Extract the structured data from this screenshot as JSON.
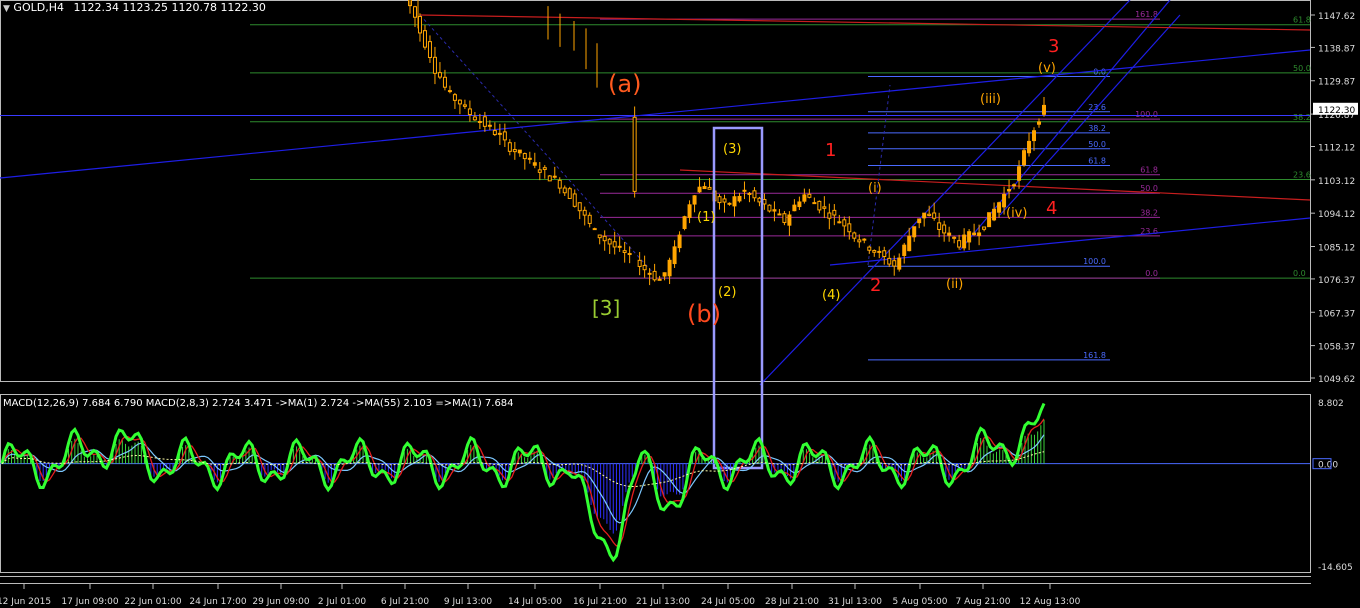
{
  "header": {
    "symbol": "GOLD,H4",
    "ohlc": "1122.34 1123.25 1120.78 1122.30"
  },
  "macd_header": "MACD(12,26,9) 7.684 6.790 MACD(2,8,3) 2.724 3.471 ->MA(1) 2.724 ->MA(55) 2.103 =>MA(1) 7.684",
  "colors": {
    "background": "#000000",
    "bull_candle": "#ffa500",
    "bear_candle": "#ffa500",
    "trendline_blue": "#1e1ee6",
    "trendline_red": "#c81e1e",
    "fib_green": "#2e8b2e",
    "fib_blue": "#4a6aff",
    "fib_purple": "#9a2a9a",
    "macd_fast": "#32ff32",
    "macd_signal_red": "#e61e1e",
    "macd_hist_blue": "#3030ff",
    "macd_hist_green": "#3cd23c",
    "macd_slow_line": "#7cc8ff",
    "box": "#9a9aff"
  },
  "chart_data": {
    "type": "candlestick",
    "instrument": "GOLD",
    "timeframe": "H4",
    "price_ticks": [
      "1147.62",
      "1138.87",
      "1129.87",
      "1120.87",
      "1112.12",
      "1103.12",
      "1094.12",
      "1085.12",
      "1076.37",
      "1067.37",
      "1058.37",
      "1049.62"
    ],
    "current_price": "1122.30",
    "ylim": [
      1049.62,
      1147.62
    ],
    "x_ticks": [
      "12 Jun 2015",
      "17 Jun 09:00",
      "22 Jun 01:00",
      "24 Jun 17:00",
      "29 Jun 09:00",
      "2 Jul 01:00",
      "6 Jul 21:00",
      "9 Jul 13:00",
      "14 Jul 05:00",
      "16 Jul 21:00",
      "21 Jul 13:00",
      "24 Jul 05:00",
      "28 Jul 21:00",
      "31 Jul 13:00",
      "5 Aug 05:00",
      "7 Aug 21:00",
      "12 Aug 13:00"
    ],
    "close_path": [
      1152,
      1150,
      1147,
      1143,
      1140,
      1137,
      1133,
      1131,
      1128,
      1126,
      1125,
      1124,
      1122,
      1121,
      1120,
      1119,
      1118,
      1117,
      1116,
      1115,
      1113,
      1112,
      1111,
      1110,
      1109,
      1108,
      1107,
      1106,
      1105,
      1104,
      1103,
      1102,
      1100,
      1099,
      1097,
      1095,
      1093,
      1091,
      1089,
      1088,
      1087,
      1086,
      1085,
      1084,
      1083,
      1082,
      1081,
      1080,
      1079,
      1078,
      1077,
      1076,
      1078,
      1081,
      1084,
      1089,
      1093,
      1097,
      1100,
      1101,
      1102,
      1100,
      1098,
      1097,
      1096,
      1097,
      1098,
      1099,
      1100,
      1099,
      1098,
      1097,
      1096,
      1095,
      1094,
      1093,
      1092,
      1094,
      1096,
      1098,
      1099,
      1098,
      1097,
      1096,
      1095,
      1094,
      1093,
      1092,
      1091,
      1090,
      1088,
      1087,
      1086,
      1085,
      1084,
      1083,
      1082,
      1081,
      1080,
      1082,
      1085,
      1088,
      1091,
      1093,
      1094,
      1093,
      1092,
      1090,
      1089,
      1088,
      1087,
      1086,
      1087,
      1088,
      1089,
      1090,
      1091,
      1093,
      1095,
      1097,
      1099,
      1101,
      1103,
      1106,
      1110,
      1114,
      1117,
      1120,
      1122
    ],
    "wave_labels": [
      "(a)",
      "[3]",
      "(b)",
      "(1)",
      "(2)",
      "(3)",
      "(4)",
      "1",
      "2",
      "3",
      "4",
      "(i)",
      "(ii)",
      "(iii)",
      "(iv)",
      "(v)"
    ],
    "fib_levels_left": [
      "61.8",
      "50.0",
      "38.2",
      "23.6",
      "0.0"
    ],
    "fib_levels_a": [
      "0.0",
      "23.6",
      "38.2",
      "50.0",
      "61.8",
      "100.0",
      "161.8"
    ],
    "fib_levels_b": [
      "161.8",
      "100.0",
      "61.8",
      "50.0",
      "38.2",
      "23.6",
      "0.0"
    ],
    "macd_ticks": [
      "8.802",
      "0.00",
      "-14.605"
    ],
    "macd_ylim": [
      -14.605,
      8.802
    ]
  }
}
